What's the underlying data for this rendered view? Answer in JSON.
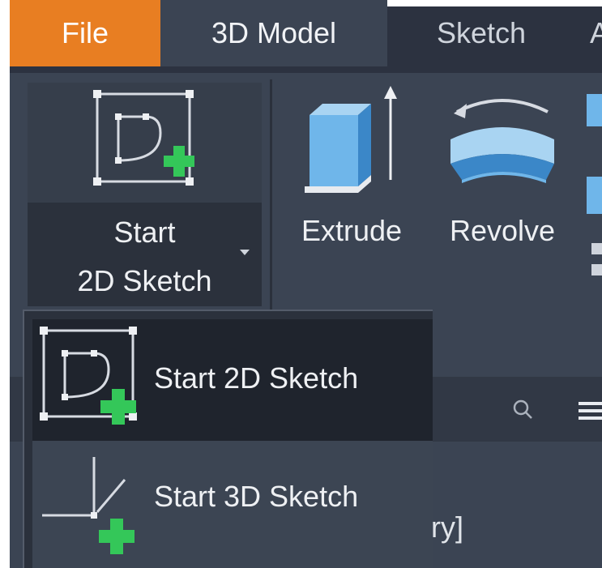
{
  "tabs": [
    {
      "label": "File"
    },
    {
      "label": "3D Model"
    },
    {
      "label": "Sketch"
    },
    {
      "label": "A"
    }
  ],
  "start_panel": {
    "label_line1": "Start",
    "label_line2": "2D Sketch",
    "icon": "start-2d-sketch-icon"
  },
  "tools": [
    {
      "label": "Extrude",
      "icon": "extrude-icon"
    },
    {
      "label": "Revolve",
      "icon": "revolve-icon"
    }
  ],
  "browser_partial_text": "ary]",
  "dropdown": {
    "items": [
      {
        "label": "Start 2D Sketch",
        "icon": "start-2d-sketch-icon"
      },
      {
        "label": "Start 3D Sketch",
        "icon": "start-3d-sketch-icon"
      }
    ]
  },
  "colors": {
    "file_tab": "#e87e22",
    "plus_green": "#34c759",
    "dark_panel": "#2b313c",
    "selected_item": "#1f242d"
  }
}
